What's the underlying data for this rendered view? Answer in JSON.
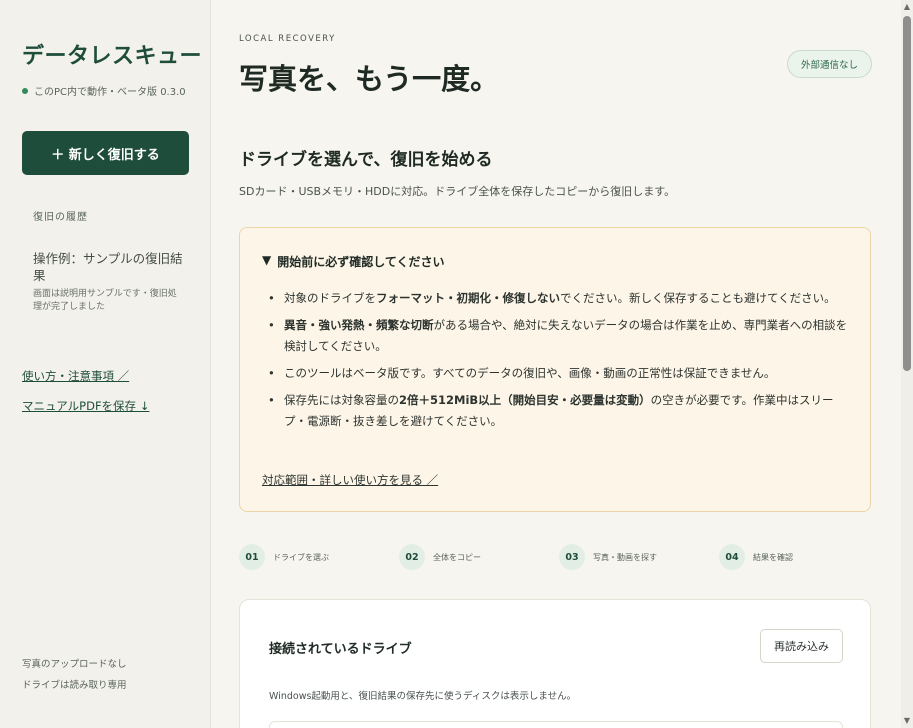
{
  "sidebar": {
    "brand": "データレスキュー",
    "status": "このPC内で動作・ベータ版 0.3.0",
    "new_button": "＋ 新しく復旧する",
    "history_heading": "復旧の履歴",
    "history_item": {
      "title": "操作例：サンプルの復旧結果",
      "note": "画面は説明用サンプルです・復旧処理が完了しました"
    },
    "link_usage": "使い方・注意事項 ／",
    "link_manual": "マニュアルPDFを保存 ↓",
    "footer_line1": "写真のアップロードなし",
    "footer_line2": "ドライブは読み取り専用"
  },
  "main": {
    "eyebrow": "LOCAL RECOVERY",
    "title": "写真を、もう一度。",
    "badge": "外部通信なし",
    "section_title": "ドライブを選んで、復旧を始める",
    "section_subtitle": "SDカード・USBメモリ・HDDに対応。ドライブ全体を保存したコピーから復旧します。",
    "warning": {
      "toggle_icon": "▼",
      "heading": "開始前に必ず確認してください",
      "items": [
        {
          "pre": "対象のドライブを",
          "bold": "フォーマット・初期化・修復しない",
          "post": "でください。新しく保存することも避けてください。"
        },
        {
          "pre": "",
          "bold": "異音・強い発熱・頻繁な切断",
          "post": "がある場合や、絶対に失えないデータの場合は作業を止め、専門業者への相談を検討してください。"
        },
        {
          "pre": "このツールはベータ版です。すべてのデータの復旧や、画像・動画の正常性は保証できません。",
          "bold": "",
          "post": ""
        },
        {
          "pre": "保存先には対象容量の",
          "bold": "2倍＋512MiB以上（開始目安・必要量は変動）",
          "post": "の空きが必要です。作業中はスリープ・電源断・抜き差しを避けてください。"
        }
      ],
      "link": "対応範囲・詳しい使い方を見る ／"
    },
    "steps": [
      {
        "num": "01",
        "label": "ドライブを選ぶ"
      },
      {
        "num": "02",
        "label": "全体をコピー"
      },
      {
        "num": "03",
        "label": "写真・動画を探す"
      },
      {
        "num": "04",
        "label": "結果を確認"
      }
    ],
    "drives_card": {
      "title": "接続されているドライブ",
      "reload_button": "再読み込み",
      "note": "Windows起動用と、復旧結果の保存先に使うディスクは表示しません。"
    }
  },
  "scrollbar": {
    "up": "▲",
    "down": "▼"
  },
  "colors": {
    "accent": "#1f4d3c",
    "warning_bg": "#fdf5e7",
    "badge_bg": "#eaf3ec"
  }
}
